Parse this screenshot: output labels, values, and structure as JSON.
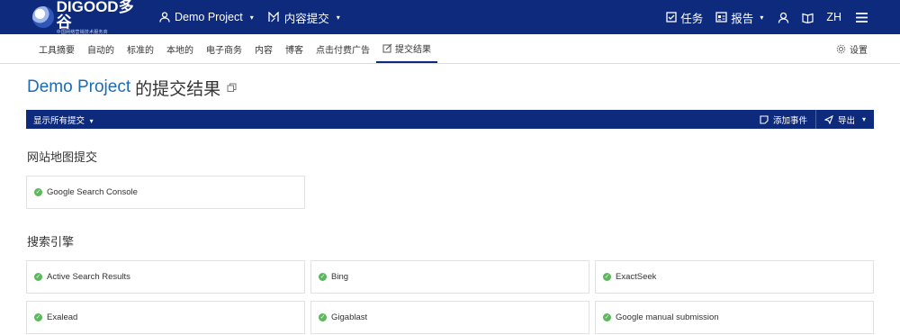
{
  "header": {
    "logo_text": "DIGOOD多谷",
    "logo_sub": "中国网络营销技术服务商",
    "project_menu": "Demo Project",
    "content_menu": "内容提交",
    "tasks": "任务",
    "reports": "报告",
    "lang": "ZH"
  },
  "subnav": {
    "items": [
      "工具摘要",
      "自动的",
      "标准的",
      "本地的",
      "电子商务",
      "内容",
      "博客",
      "点击付费广告",
      "提交结果"
    ],
    "active": "提交结果",
    "settings": "设置"
  },
  "page": {
    "title_project": "Demo Project",
    "title_rest": "的提交结果"
  },
  "toolbar": {
    "show_all": "显示所有提交",
    "add_event": "添加事件",
    "export": "导出"
  },
  "sections": {
    "sitemap": {
      "title": "网站地图提交",
      "items": [
        "Google Search Console"
      ]
    },
    "engines": {
      "title": "搜索引擎",
      "items": [
        "Active Search Results",
        "Bing",
        "ExactSeek",
        "Exalead",
        "Gigablast",
        "Google manual submission"
      ]
    }
  },
  "colors": {
    "brand": "#0d2a7d",
    "link": "#1d6bb5",
    "success": "#5cb85c"
  }
}
